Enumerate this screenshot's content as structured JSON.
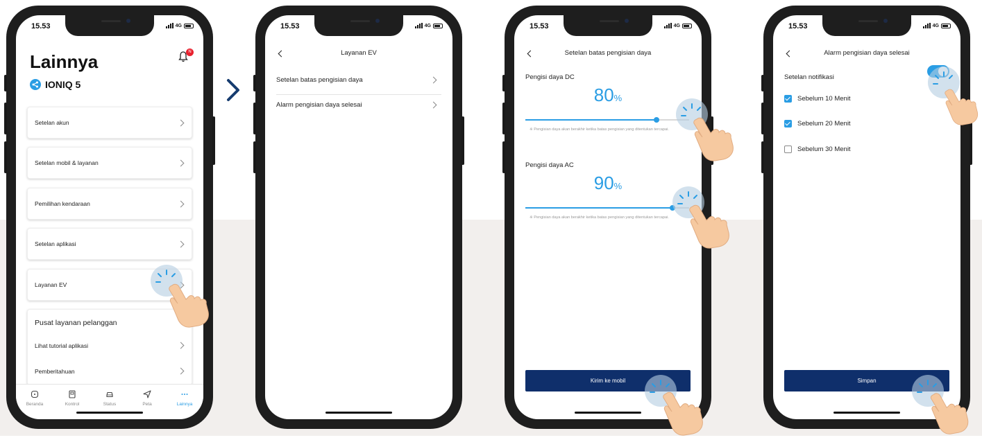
{
  "status": {
    "time": "15.53",
    "network": "4G"
  },
  "colors": {
    "accent": "#2a9de4",
    "primary_button": "#0f2f6b",
    "navy_arrow": "#163c6f",
    "background_band": "#f2efed"
  },
  "screen1": {
    "title": "Lainnya",
    "notification_badge": "N",
    "vehicle_name": "IONIQ 5",
    "menu": [
      {
        "label": "Setelan akun"
      },
      {
        "label": "Setelan mobil & layanan"
      },
      {
        "label": "Pemilihan kendaraan"
      },
      {
        "label": "Setelan aplikasi"
      },
      {
        "label": "Layanan EV"
      }
    ],
    "customer_center": {
      "heading": "Pusat layanan pelanggan",
      "items": [
        {
          "label": "Lihat tutorial aplikasi"
        },
        {
          "label": "Pemberitahuan"
        }
      ]
    },
    "tabs": [
      {
        "label": "Beranda",
        "icon": "home-icon"
      },
      {
        "label": "Kontrol",
        "icon": "remote-icon"
      },
      {
        "label": "Status",
        "icon": "car-icon"
      },
      {
        "label": "Peta",
        "icon": "navigation-icon"
      },
      {
        "label": "Lainnya",
        "icon": "more-icon",
        "active": true
      }
    ]
  },
  "screen2": {
    "title": "Layanan EV",
    "items": [
      {
        "label": "Setelan batas pengisian daya"
      },
      {
        "label": "Alarm pengisian daya selesai"
      }
    ]
  },
  "screen3": {
    "title": "Setelan batas pengisian daya",
    "dc": {
      "label": "Pengisi daya DC",
      "value": "80",
      "unit": "%",
      "level": 80,
      "note": "※ Pengisian daya akan berakhir ketika batas pengisian yang ditentukan tercapai."
    },
    "ac": {
      "label": "Pengisi daya AC",
      "value": "90",
      "unit": "%",
      "level": 90,
      "note": "※ Pengisian daya akan berakhir ketika batas pengisian yang ditentukan tercapai."
    },
    "button": "Kirim ke mobil"
  },
  "screen4": {
    "title": "Alarm pengisian daya selesai",
    "notification_label": "Setelan notifikasi",
    "notification_on": true,
    "options": [
      {
        "label": "Sebelum 10 Menit",
        "checked": true
      },
      {
        "label": "Sebelum 20 Menit",
        "checked": true
      },
      {
        "label": "Sebelum 30 Menit",
        "checked": false
      }
    ],
    "button": "Simpan"
  }
}
